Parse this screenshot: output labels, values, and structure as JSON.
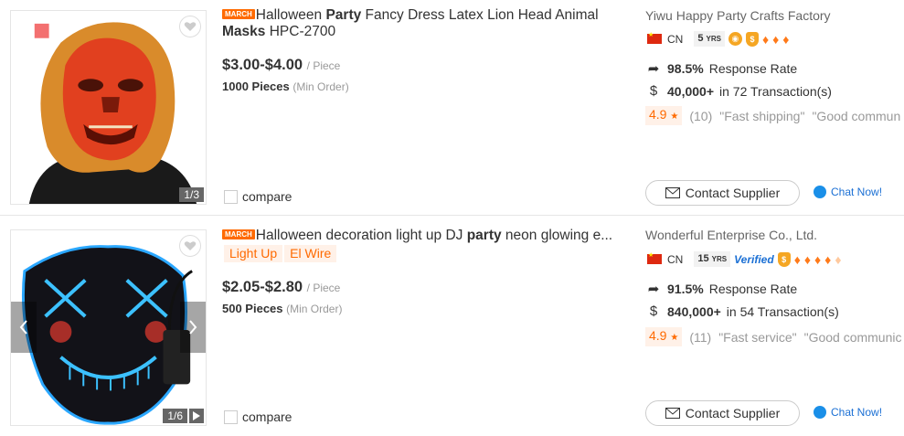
{
  "products": [
    {
      "march_tag": "MARCH",
      "title_pre": "Halloween ",
      "title_bold": "Party",
      "title_mid": " Fancy Dress Latex Lion Head Animal ",
      "title_bold2": "Masks",
      "title_post": " HPC-2700",
      "keyword_tags": [],
      "price": "$3.00-$4.00",
      "price_unit": "/ Piece",
      "moq": "1000 Pieces",
      "moq_unit": "(Min Order)",
      "image_counter": "1/3",
      "compare_label": "compare",
      "supplier": "Yiwu Happy Party Crafts Factory",
      "country": "CN",
      "years": "5",
      "years_unit": "YRS",
      "response_rate": "98.5%",
      "response_label": "Response Rate",
      "transactions_value": "40,000+",
      "transactions_label": "in 72 Transaction(s)",
      "rating": "4.9",
      "review_count": "(10)",
      "review_1": "\"Fast shipping\"",
      "review_2": "\"Good commun",
      "contact_label": "Contact Supplier",
      "chat_label": "Chat Now!"
    },
    {
      "march_tag": "MARCH",
      "title_pre": "Halloween decoration light up DJ ",
      "title_bold": "party",
      "title_mid": " neon glowing e...",
      "title_bold2": "",
      "title_post": "",
      "keyword_tags": [
        "Light Up",
        "El Wire"
      ],
      "price": "$2.05-$2.80",
      "price_unit": "/ Piece",
      "moq": "500 Pieces",
      "moq_unit": "(Min Order)",
      "image_counter": "1/6",
      "compare_label": "compare",
      "supplier": "Wonderful Enterprise Co., Ltd.",
      "country": "CN",
      "years": "15",
      "years_unit": "YRS",
      "verified_label": "Verified",
      "response_rate": "91.5%",
      "response_label": "Response Rate",
      "transactions_value": "840,000+",
      "transactions_label": "in 54 Transaction(s)",
      "rating": "4.9",
      "review_count": "(11)",
      "review_1": "\"Fast service\"",
      "review_2": "\"Good communic",
      "contact_label": "Contact Supplier",
      "chat_label": "Chat Now!"
    }
  ],
  "colors": {
    "accent": "#ff6a00",
    "link_blue": "#1a6fd4",
    "tag_bg": "#fff1e8"
  }
}
